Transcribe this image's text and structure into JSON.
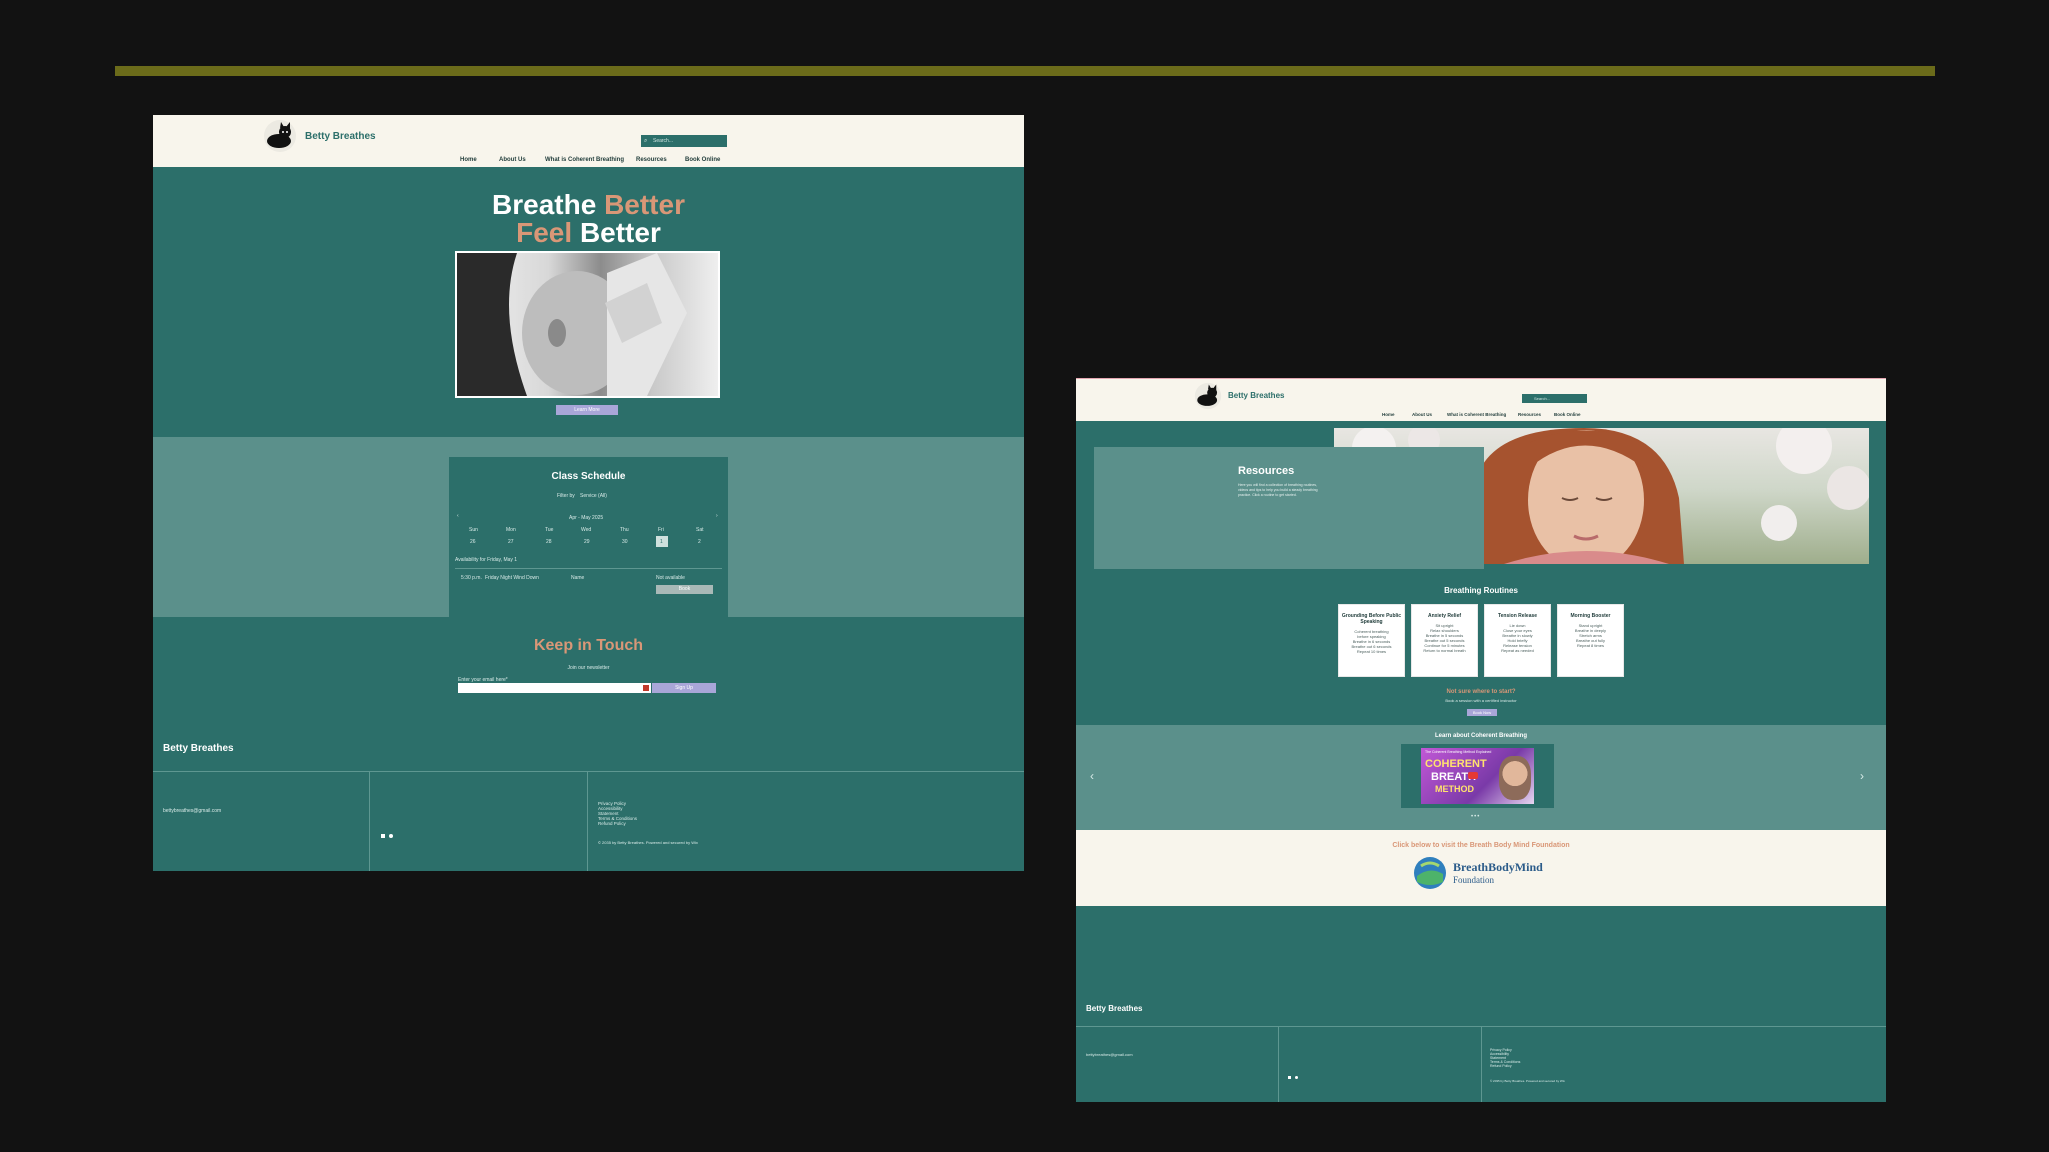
{
  "colors": {
    "accent_bar": "#6b6b1a",
    "teal": "#2c6f6a",
    "teal_light": "#5b908b",
    "salmon": "#d99777",
    "cream": "#f8f5ec",
    "lavender": "#a9a6d8"
  },
  "left": {
    "brand": "Betty Breathes",
    "logo_icon": "cat-logo-icon",
    "search_placeholder": "Search...",
    "nav": [
      "Home",
      "About Us",
      "What is Coherent Breathing",
      "Resources",
      "Book Online"
    ],
    "hero": {
      "w1": "Breathe",
      "w2": "Better",
      "w3": "Feel",
      "w4": "Better",
      "button": "Learn More"
    },
    "schedule": {
      "title": "Class Schedule",
      "filter_label": "Filter by",
      "filter_value": "Service (All)",
      "range": "Apr - May 2025",
      "days": [
        "Sun",
        "Mon",
        "Tue",
        "Wed",
        "Thu",
        "Fri",
        "Sat"
      ],
      "dates": [
        "26",
        "27",
        "28",
        "29",
        "30",
        "1",
        "2"
      ],
      "availability": "Availability for Friday, May 1",
      "slot_time": "5:30 p.m.",
      "slot_name": "Friday Night Wind Down",
      "slot_col": "Name",
      "slot_extra": "Not available",
      "book": "Book"
    },
    "keep": {
      "title": "Keep in Touch",
      "sub": "Join our newsletter",
      "email_label": "Enter your email here*",
      "signup": "Sign Up"
    },
    "footer": {
      "brand": "Betty Breathes",
      "email": "bettybreathes@gmail.com",
      "links": [
        "Privacy Policy",
        "Accessibility",
        "Statement",
        "Terms & Conditions",
        "Refund Policy"
      ],
      "copyright": "© 2035 by Betty Breathes. Powered and secured by Wix"
    }
  },
  "right": {
    "brand": "Betty Breathes",
    "search_placeholder": "Search...",
    "nav": [
      "Home",
      "About Us",
      "What is Coherent Breathing",
      "Resources",
      "Book Online"
    ],
    "resources": {
      "title": "Resources",
      "body": "Here you will find a collection of breathing routines, videos and tips to help you build a steady breathing practice. Click a routine to get started."
    },
    "routines_title": "Breathing Routines",
    "routines": [
      {
        "title": "Grounding Before Public Speaking",
        "body": "Coherent breathing\nbefore speaking\nBreathe in 6 seconds\nBreathe out 6 seconds\nRepeat 10 times"
      },
      {
        "title": "Anxiety Relief",
        "body": "Sit upright\nRelax shoulders\nBreathe in 5 seconds\nBreathe out 5 seconds\nContinue for 5 minutes\nReturn to normal breath"
      },
      {
        "title": "Tension Release",
        "body": "Lie down\nClose your eyes\nBreathe in slowly\nHold briefly\nRelease tension\nRepeat as needed"
      },
      {
        "title": "Morning Booster",
        "body": "Stand upright\nBreathe in deeply\nStretch arms\nBreathe out fully\nRepeat 8 times"
      }
    ],
    "not_sure": "Not sure where to start?",
    "not_sure_sub": "Book a session with a certified instructor",
    "not_sure_btn": "Book Now",
    "learn_title": "Learn about Coherent Breathing",
    "video": {
      "line1": "COHERENT",
      "line2": "BREATH",
      "line3": "METHOD",
      "caption": "The Coherent Breathing Method Explained"
    },
    "visit": "Click below to visit the Breath Body Mind Foundation",
    "bbm_name": "BreathBodyMind",
    "bbm_sub": "Foundation",
    "footer": {
      "brand": "Betty Breathes",
      "email": "bettybreathes@gmail.com",
      "links": [
        "Privacy Policy",
        "Accessibility",
        "Statement",
        "Terms & Conditions",
        "Refund Policy"
      ],
      "copyright": "© 2035 by Betty Breathes. Powered and secured by Wix"
    }
  }
}
